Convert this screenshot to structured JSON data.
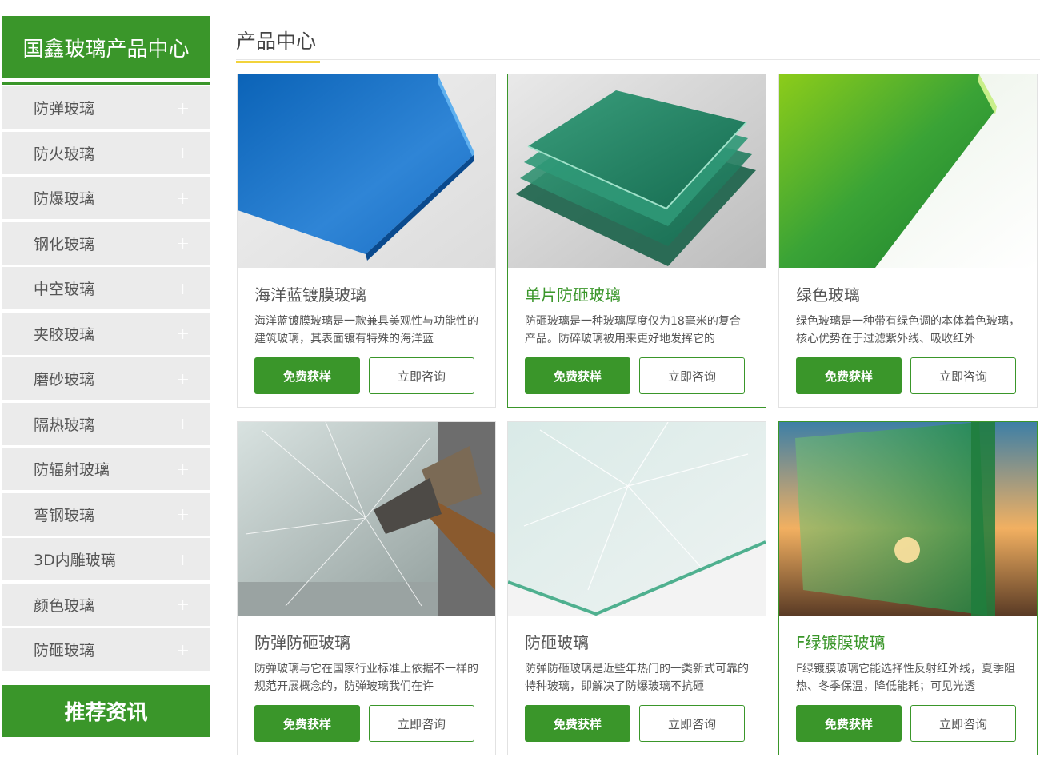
{
  "sidebar": {
    "title": "国鑫玻璃产品中心",
    "items": [
      {
        "label": "防弹玻璃",
        "icon": "+"
      },
      {
        "label": "防火玻璃",
        "icon": "+"
      },
      {
        "label": "防爆玻璃",
        "icon": "+"
      },
      {
        "label": "钢化玻璃",
        "icon": "+"
      },
      {
        "label": "中空玻璃",
        "icon": "+"
      },
      {
        "label": "夹胶玻璃",
        "icon": "+"
      },
      {
        "label": "磨砂玻璃",
        "icon": "+"
      },
      {
        "label": "隔热玻璃",
        "icon": "+"
      },
      {
        "label": "防辐射玻璃",
        "icon": "+"
      },
      {
        "label": "弯钢玻璃",
        "icon": "+"
      },
      {
        "label": "3D内雕玻璃",
        "icon": "+"
      },
      {
        "label": "颜色玻璃",
        "icon": "+"
      },
      {
        "label": "防砸玻璃",
        "icon": "+"
      }
    ],
    "footer_title": "推荐资讯"
  },
  "main": {
    "title": "产品中心",
    "products": [
      {
        "name": "海洋蓝镀膜玻璃",
        "desc": "海洋蓝镀膜玻璃是一款兼具美观性与功能性的建筑玻璃，其表面镀有特殊的海洋蓝",
        "btn_sample": "免费获样",
        "btn_consult": "立即咨询"
      },
      {
        "name": "单片防砸玻璃",
        "desc": "防砸玻璃是一种玻璃厚度仅为18毫米的复合产品。防碎玻璃被用来更好地发挥它的",
        "btn_sample": "免费获样",
        "btn_consult": "立即咨询"
      },
      {
        "name": "绿色玻璃",
        "desc": "绿色玻璃是一种带有绿色调的本体着色玻璃，核心优势在于过滤紫外线、吸收红外",
        "btn_sample": "免费获样",
        "btn_consult": "立即咨询"
      },
      {
        "name": "防弹防砸玻璃",
        "desc": "防弹玻璃与它在国家行业标准上依据不一样的规范开展概念的，防弹玻璃我们在许",
        "btn_sample": "免费获样",
        "btn_consult": "立即咨询"
      },
      {
        "name": "防砸玻璃",
        "desc": "防弹防砸玻璃是近些年热门的一类新式可靠的特种玻璃，即解决了防爆玻璃不抗砸",
        "btn_sample": "免费获样",
        "btn_consult": "立即咨询"
      },
      {
        "name": "F绿镀膜玻璃",
        "desc": "F绿镀膜玻璃它能选择性反射红外线，夏季阻热、冬季保温，降低能耗；可见光透",
        "btn_sample": "免费获样",
        "btn_consult": "立即咨询"
      }
    ]
  },
  "colors": {
    "brand_green": "#3a962a",
    "accent_yellow": "#f2d33b",
    "sidebar_bg": "#ebebeb"
  }
}
